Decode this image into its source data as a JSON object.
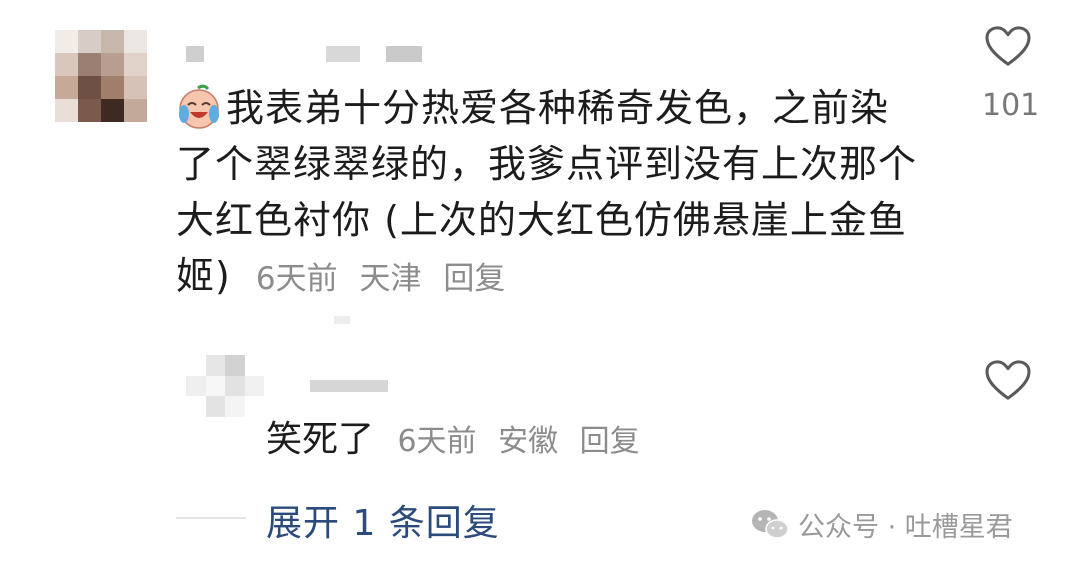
{
  "comment": {
    "text_line1": "我表弟十分热爱各种稀奇发色，之前染",
    "text_line2": "了个翠绿翠绿的，我爹点评到没有上次那个",
    "text_line3": "大红色衬你 (上次的大红色仿佛悬崖上金鱼",
    "text_line4": "姬)",
    "time": "6天前",
    "location": "天津",
    "reply_label": "回复",
    "like_count": "101",
    "emoji_icon": "laughing-crying-emoji-icon"
  },
  "reply": {
    "text": "笑死了",
    "time": "6天前",
    "location": "安徽",
    "reply_label": "回复"
  },
  "expand": {
    "label": "展开 1 条回复"
  },
  "watermark": {
    "text": "公众号 · 吐槽星君",
    "icon": "wechat-icon"
  },
  "colors": {
    "link_blue": "#2a4b7c",
    "meta_gray": "#8c8c8c",
    "text_dark": "#1c1c1c"
  }
}
